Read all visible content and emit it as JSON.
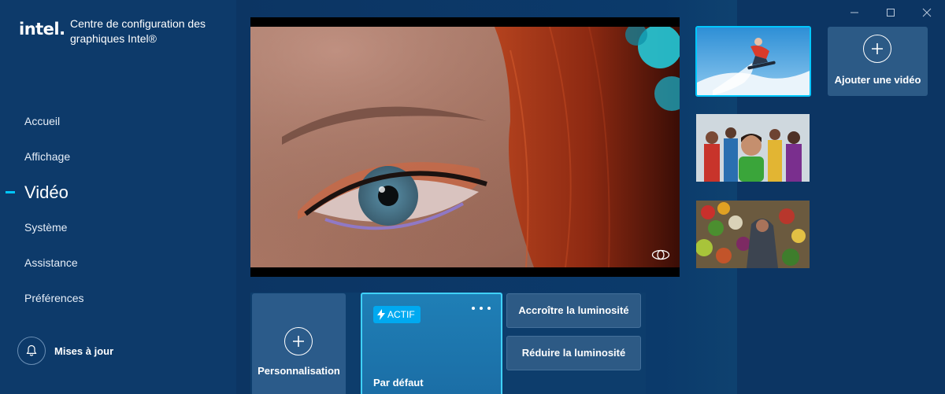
{
  "app": {
    "logo_text": "intel",
    "title": "Centre de configuration des graphiques Intel®"
  },
  "nav": {
    "items": [
      {
        "label": "Accueil",
        "active": false
      },
      {
        "label": "Affichage",
        "active": false
      },
      {
        "label": "Vidéo",
        "active": true
      },
      {
        "label": "Système",
        "active": false
      },
      {
        "label": "Assistance",
        "active": false
      },
      {
        "label": "Préférences",
        "active": false
      }
    ]
  },
  "updates": {
    "label": "Mises à jour",
    "icon": "bell-icon"
  },
  "window_controls": [
    "minimize-icon",
    "maximize-icon",
    "close-icon"
  ],
  "player": {
    "preview_toggle_icon": "eye-icon"
  },
  "thumbnails": [
    {
      "subject": "snowboarder",
      "selected": true
    },
    {
      "subject": "group-of-people",
      "selected": false
    },
    {
      "subject": "market-vegetables",
      "selected": false
    }
  ],
  "add_video": {
    "label": "Ajouter une vidéo",
    "icon": "plus-icon"
  },
  "presets": {
    "custom": {
      "label": "Personnalisation",
      "icon": "plus-icon"
    },
    "default": {
      "badge": "ACTIF",
      "label": "Par défaut",
      "more_icon": "more-dots-icon"
    },
    "actions": {
      "increase": "Accroître la luminosité",
      "decrease": "Réduire la luminosité"
    }
  },
  "colors": {
    "accent": "#00c7fd",
    "sidebar_bg": "#0d3a6a",
    "main_bg": "#0c3563",
    "active_card": "#1f7fb6",
    "badge": "#00a9f0"
  }
}
